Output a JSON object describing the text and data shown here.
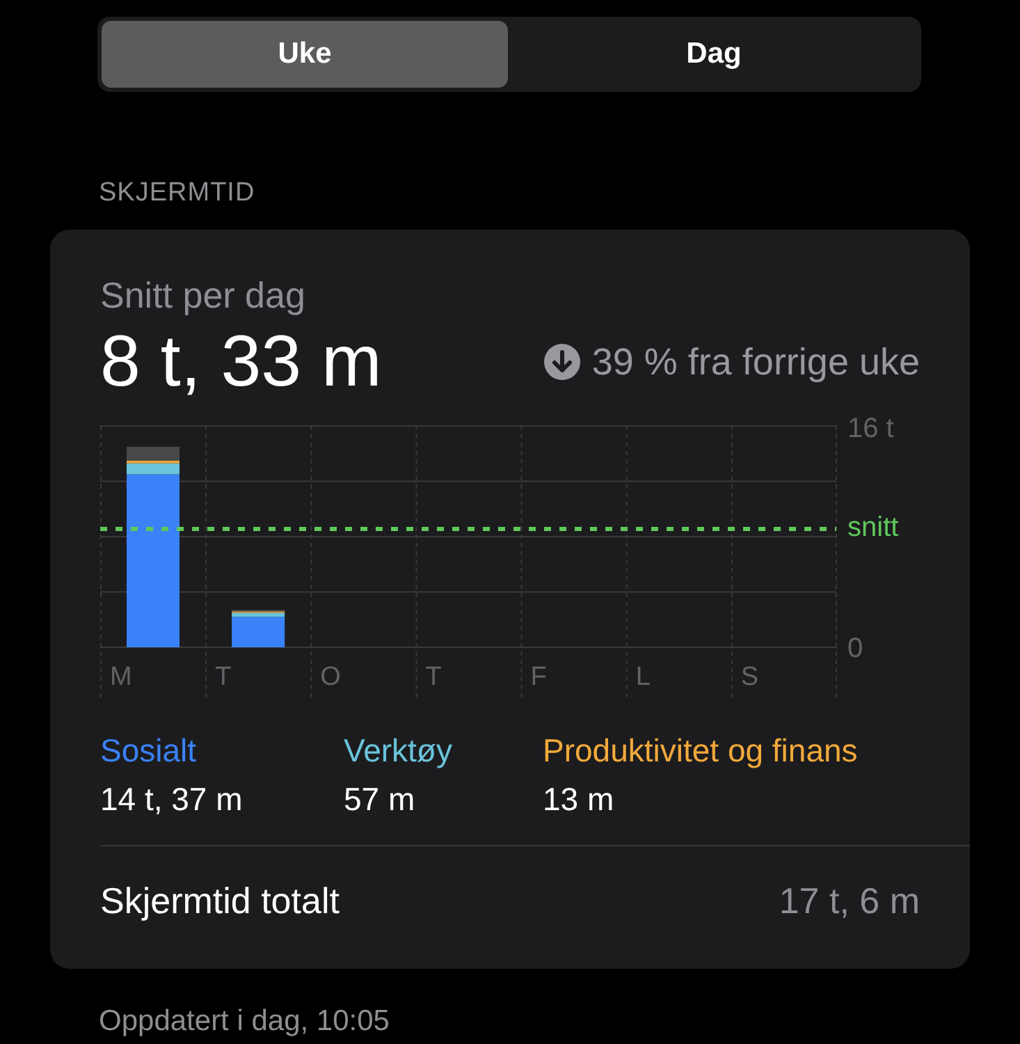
{
  "tabs": [
    {
      "label": "Uke",
      "selected": true
    },
    {
      "label": "Dag",
      "selected": false
    }
  ],
  "section_title": "SKJERMTID",
  "card": {
    "title": "Snitt per dag",
    "average": "8 t, 33 m",
    "change": "39 % fra forrige uke",
    "chart_data": {
      "type": "bar",
      "stacked": true,
      "categories": [
        "M",
        "T",
        "O",
        "T",
        "F",
        "L",
        "S"
      ],
      "series": [
        {
          "name": "Sosialt",
          "color": "#3a82f7",
          "values": [
            12.5,
            2.2,
            0,
            0,
            0,
            0,
            0
          ]
        },
        {
          "name": "Verktøy",
          "color": "#6ac4dc",
          "values": [
            0.8,
            0.3,
            0,
            0,
            0,
            0,
            0
          ]
        },
        {
          "name": "Produktivitet og finans",
          "color": "#f2a93b",
          "values": [
            0.2,
            0.1,
            0,
            0,
            0,
            0,
            0
          ]
        },
        {
          "color": "#48484a",
          "values": [
            1,
            0.1,
            0,
            0,
            0,
            0,
            0
          ]
        }
      ],
      "ylim": [
        0,
        16
      ],
      "yticks": [
        {
          "value": 0,
          "label": "0"
        },
        {
          "value": 16,
          "label": "16 t"
        }
      ]
    },
    "average_line_label": "snitt",
    "category_times": [
      "14 t, 37 m",
      "57 m",
      "13 m"
    ],
    "total": {
      "label": "Skjermtid totalt",
      "value": "17 t, 6 m"
    }
  },
  "footer": "Oppdatert i dag, 10:05"
}
